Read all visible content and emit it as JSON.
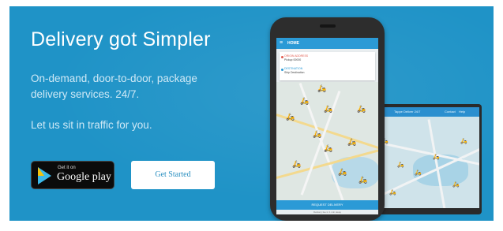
{
  "hero": {
    "title": "Delivery got Simpler",
    "description": "On-demand, door-to-door, package delivery services. 24/7.",
    "tagline": "Let us sit in traffic for you."
  },
  "buttons": {
    "google_play_small": "Get it on",
    "google_play_big": "Google play",
    "get_started": "Get Started"
  },
  "phone": {
    "app_title": "HOME",
    "menu_icon": "hamburger-icon",
    "pickup_label": "ORIGIN ADDRESS",
    "pickup_value": "Pickup 00000",
    "dropoff_label": "DESTINATION",
    "dropoff_value": "Ship Destination",
    "request_button": "REQUEST DELIVERY",
    "footer_text": "Delivery fee in 1 min away"
  },
  "laptop": {
    "header_text": "Tappe Deliver 24/7",
    "link1": "Contact",
    "link2": "Help"
  },
  "colors": {
    "banner": "#1f93c7",
    "accent": "#2b9ad6"
  }
}
